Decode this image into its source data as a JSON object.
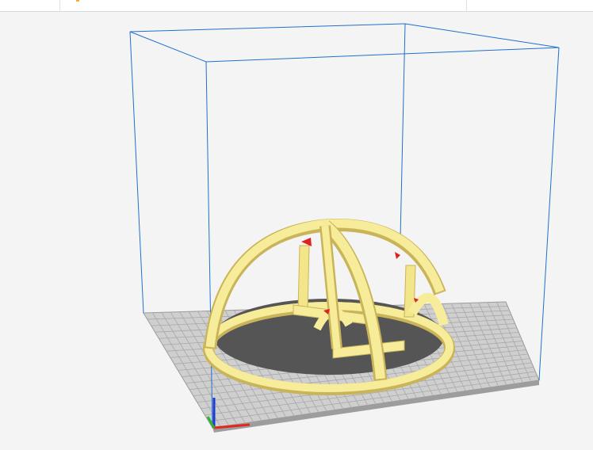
{
  "colors": {
    "background": "#f4f4f4",
    "build_volume_outline": "#1f6fd0",
    "plate": "#cfcfcf",
    "plate_grid": "#a8a8a8",
    "plate_edge": "#9a9a9a",
    "model": "#f7ec9a",
    "model_edge": "#c9b45a",
    "overhang": "#e02020",
    "axis_x": "#e0281b",
    "axis_y": "#2bb52b",
    "axis_z": "#1c3bd6",
    "accent": "#f6a623"
  },
  "icons": {
    "axis": "xyz-axis-icon"
  }
}
